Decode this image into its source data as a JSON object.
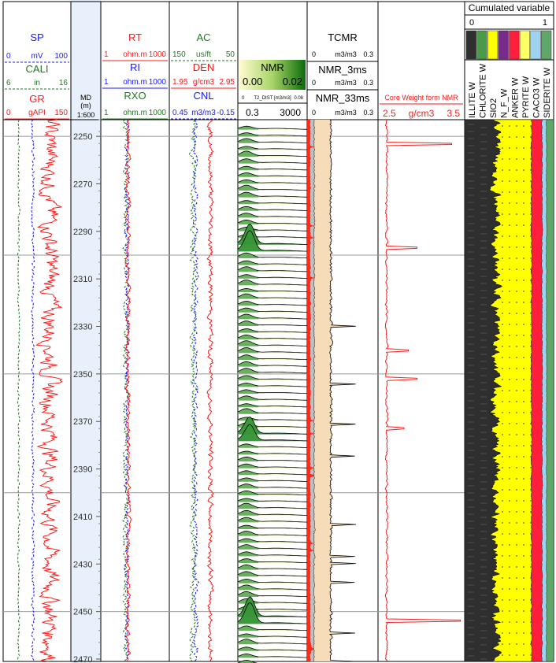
{
  "colors": {
    "red": "#ff1a1a",
    "blue": "#1a1aff",
    "green": "#1f7a1f",
    "shale": "#2f2f2f",
    "silica": "#ffff00",
    "orange_fill": "#f6dcb8",
    "grey_fill": "#bfbfbf",
    "pyrite": "#ff1e3c",
    "calcite": "#9fd2ee",
    "siderite": "#5fa76a",
    "nmr_low": "#fffbd0",
    "nmr_high": "#0a6b0a",
    "depth_track": "#e8f1fb"
  },
  "header": {
    "track1": {
      "sp": {
        "name": "SP",
        "min": "0",
        "unit": "mV",
        "max": "100"
      },
      "cali": {
        "name": "CALI",
        "min": "6",
        "unit": "in",
        "max": "16"
      },
      "gr": {
        "name": "GR",
        "min": "0",
        "unit": "gAPI",
        "max": "150"
      }
    },
    "depth": {
      "label": "MD",
      "unit": "(m)",
      "scale": "1:600"
    },
    "track3": {
      "rt": {
        "name": "RT",
        "min": "1",
        "unit": "ohm.m",
        "max": "1000"
      },
      "ri": {
        "name": "RI",
        "min": "1",
        "unit": "ohm.m",
        "max": "1000"
      },
      "rxo": {
        "name": "RXO",
        "min": "1",
        "unit": "ohm.m",
        "max": "1000"
      }
    },
    "track4": {
      "ac": {
        "name": "AC",
        "min": "150",
        "unit": "us/ft",
        "max": "50"
      },
      "den": {
        "name": "DEN",
        "min": "1.95",
        "unit": "g/cm3",
        "max": "2.95"
      },
      "cnl": {
        "name": "CNL",
        "min": "0.45",
        "unit": "m3/m3",
        "max": "-0.15"
      }
    },
    "track5": {
      "nmr": {
        "name": "NMR",
        "min": "0.00",
        "max": "0.02"
      },
      "t2": {
        "min": "0",
        "label": "T2_DIST [m3/m3]",
        "max": "0.08"
      },
      "range": {
        "min": "0.3",
        "max": "3000"
      }
    },
    "track6": {
      "tcmr": {
        "name": "TCMR",
        "min": "0",
        "unit": "m3/m3",
        "max": "0.3"
      },
      "nmr3": {
        "name": "NMR_3ms",
        "min": "0",
        "unit": "m3/m3",
        "max": "0.3"
      },
      "nmr33": {
        "name": "NMR_33ms",
        "min": "0",
        "unit": "m3/m3",
        "max": "0.3"
      }
    },
    "track7": {
      "core": {
        "name": "Core Weight form NMR",
        "min": "2.5",
        "unit": "g/cm3",
        "max": "3.5"
      }
    },
    "track8": {
      "title": "Cumulated variable",
      "min": "0",
      "max": "1",
      "minerals": [
        "ILLITE W",
        "CHLORITE W",
        "SIO2",
        "N_F_W",
        "ANKER W",
        "PYRITE W",
        "CACO3 W",
        "SIDERITE W"
      ]
    }
  },
  "chart_data": {
    "type": "line",
    "title": "",
    "depth_axis": {
      "label": "MD",
      "unit": "(m)",
      "range": [
        2243,
        2471
      ],
      "ticks": [
        2250,
        2270,
        2290,
        2310,
        2330,
        2350,
        2370,
        2390,
        2410,
        2430,
        2450,
        2470
      ]
    },
    "highlight_depths": [
      2250,
      2300,
      2350,
      2400,
      2450
    ],
    "series": [
      {
        "name": "SP",
        "track": 1,
        "typical": 44,
        "range": [
          0,
          100
        ]
      },
      {
        "name": "CALI",
        "track": 1,
        "typical": 7.8,
        "range": [
          6,
          16
        ]
      },
      {
        "name": "GR",
        "track": 1,
        "typical": 104,
        "range": [
          0,
          150
        ]
      },
      {
        "name": "RT",
        "track": 3,
        "typical_log": 1.2,
        "range": [
          1,
          1000
        ]
      },
      {
        "name": "RI",
        "track": 3,
        "typical_log": 1.15,
        "range": [
          1,
          1000
        ]
      },
      {
        "name": "RXO",
        "track": 3,
        "typical_log": 1.1,
        "range": [
          1,
          1000
        ]
      },
      {
        "name": "AC",
        "track": 4,
        "typical": 115,
        "range": [
          150,
          50
        ]
      },
      {
        "name": "DEN",
        "track": 4,
        "typical": 2.55,
        "range": [
          1.95,
          2.95
        ]
      },
      {
        "name": "CNL",
        "track": 4,
        "typical": 0.22,
        "range": [
          0.45,
          -0.15
        ]
      },
      {
        "name": "TCMR",
        "track": 6,
        "typical": 0.06,
        "range": [
          0,
          0.3
        ]
      },
      {
        "name": "NMR_3ms",
        "track": 6,
        "typical": 0.025,
        "range": [
          0,
          0.3
        ]
      },
      {
        "name": "NMR_33ms",
        "track": 6,
        "typical": 0.005,
        "range": [
          0,
          0.3
        ]
      },
      {
        "name": "Core Weight form NMR",
        "track": 7,
        "typical": 2.6,
        "range": [
          2.5,
          3.5
        ]
      }
    ],
    "core_weight_spikes": [
      {
        "depth": 2253,
        "value": 3.35
      },
      {
        "depth": 2297,
        "value": 2.95
      },
      {
        "depth": 2340,
        "value": 2.85
      },
      {
        "depth": 2352,
        "value": 2.95
      },
      {
        "depth": 2373,
        "value": 2.8
      },
      {
        "depth": 2454,
        "value": 3.45
      }
    ],
    "nmr_large_peaks": [
      {
        "depth": 2294,
        "amplitude": 0.018
      },
      {
        "depth": 2373,
        "amplitude": 0.01
      },
      {
        "depth": 2450,
        "amplitude": 0.02
      }
    ],
    "mineral_composition_typical": [
      {
        "name": "ILLITE W",
        "value": 0.35
      },
      {
        "name": "CHLORITE W",
        "value": 0.0
      },
      {
        "name": "SIO2",
        "value": 0.4
      },
      {
        "name": "N_F_W",
        "value": 0.0
      },
      {
        "name": "ANKER W",
        "value": 0.0
      },
      {
        "name": "PYRITE W",
        "value": 0.12
      },
      {
        "name": "CACO3 W",
        "value": 0.05
      },
      {
        "name": "SIDERITE W",
        "value": 0.08
      }
    ]
  }
}
